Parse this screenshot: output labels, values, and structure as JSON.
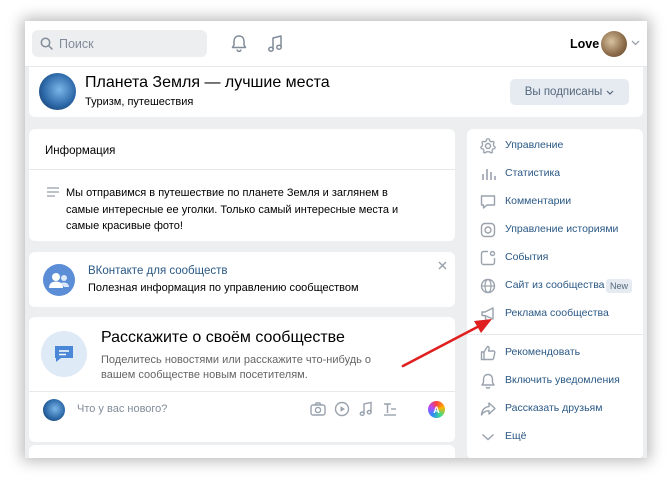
{
  "search": {
    "placeholder": "Поиск"
  },
  "user": {
    "name": "Love"
  },
  "group": {
    "title": "Планета Земля — лучшие места",
    "subtitle": "Туризм, путешествия",
    "subscribed_label": "Вы подписаны"
  },
  "info": {
    "title": "Информация",
    "text": "Мы отправимся в путешествие по планете Земля и заглянем в самые интересные ее уголки. Только самый интересные места и самые красивые фото!"
  },
  "vk_promo": {
    "title": "ВКонтакте для сообществ",
    "desc": "Полезная информация по управлению сообществом"
  },
  "story": {
    "title": "Расскажите о своём сообществе",
    "desc": "Поделитесь новостями или расскажите что-нибудь о вашем сообществе новым посетителям.",
    "post_placeholder": "Что у вас нового?"
  },
  "menu": {
    "items": [
      {
        "label": "Управление",
        "icon": "gear-icon"
      },
      {
        "label": "Статистика",
        "icon": "stats-icon"
      },
      {
        "label": "Комментарии",
        "icon": "comment-icon"
      },
      {
        "label": "Управление историями",
        "icon": "stories-icon"
      },
      {
        "label": "События",
        "icon": "events-icon"
      },
      {
        "label": "Сайт из сообщества",
        "icon": "globe-icon",
        "badge": "New"
      },
      {
        "label": "Реклама сообщества",
        "icon": "megaphone-icon"
      },
      {
        "label": "Рекомендовать",
        "icon": "thumbs-up-icon"
      },
      {
        "label": "Включить уведомления",
        "icon": "bell-icon"
      },
      {
        "label": "Рассказать друзьям",
        "icon": "share-icon"
      },
      {
        "label": "Ещё",
        "icon": "chevron-down-icon"
      }
    ]
  },
  "colors": {
    "link": "#2a5885",
    "icon": "#99a2ad",
    "arrow": "#e02020",
    "background": "#edeef0"
  }
}
